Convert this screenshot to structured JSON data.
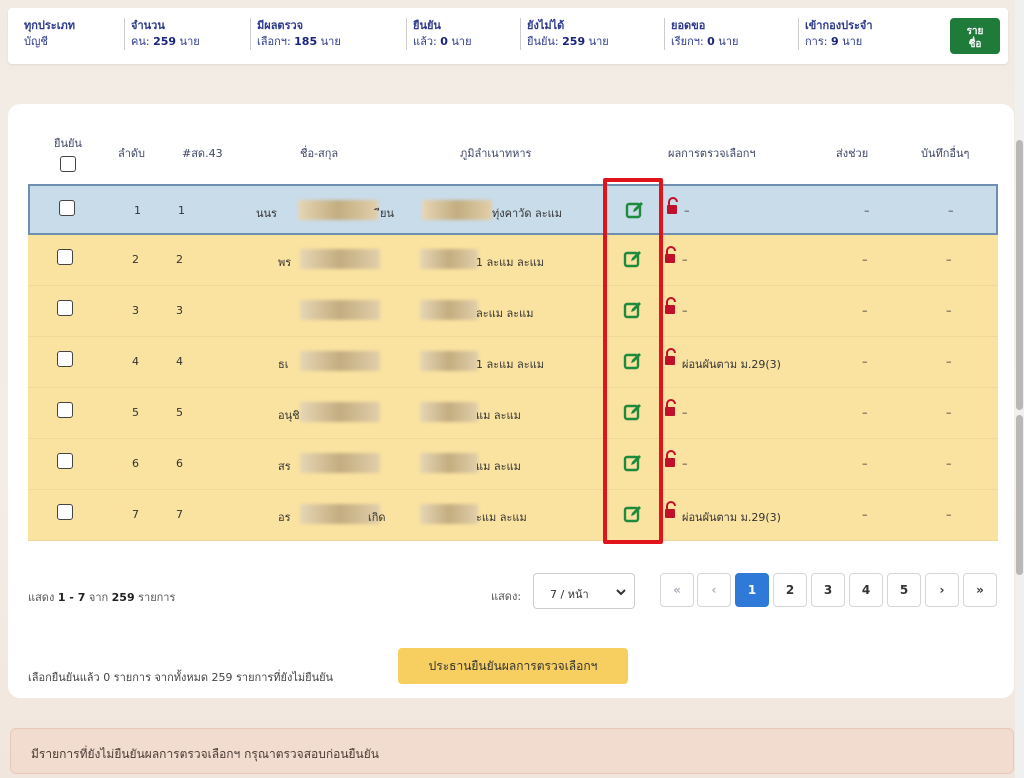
{
  "summary": {
    "types": {
      "line1": "ทุกประเภท",
      "line2": "บัญชี"
    },
    "count": {
      "line1": "จำนวน",
      "prefix": "คน: ",
      "value": "259",
      "unit": " นาย"
    },
    "has_result": {
      "line1": "มีผลตรวจ",
      "prefix": "เลือกฯ: ",
      "value": "185",
      "unit": " นาย"
    },
    "confirmed": {
      "line1": "ยืนยัน",
      "prefix": "แล้ว: ",
      "value": "0",
      "unit": " นาย"
    },
    "not_confirmed": {
      "line1": "ยังไม่ได้",
      "prefix": "ยืนยัน: ",
      "value": "259",
      "unit": " นาย"
    },
    "requested": {
      "line1": "ยอดขอ",
      "prefix": "เรียกฯ: ",
      "value": "0",
      "unit": " นาย"
    },
    "enlisted": {
      "line1": "เข้ากองประจำ",
      "prefix": "การ: ",
      "value": "9",
      "unit": " นาย"
    },
    "list_button": {
      "line1": "ราย",
      "line2": "ชื่อ"
    }
  },
  "table": {
    "headers": {
      "confirm": "ยืนยัน",
      "order": "ลำดับ",
      "sd43": "#สด.43",
      "name": "ชื่อ-สกุล",
      "domicile": "ภูมิลำเนาทหาร",
      "result": "ผลการตรวจเลือกฯ",
      "send": "ส่งช่วย",
      "note": "บันทึกอื่นๆ"
    },
    "rows": [
      {
        "order": "1",
        "sd43": "1",
        "name_a": "นนร",
        "name_b": "ียน",
        "domicile": "ทุ่งคาวัด ละแม",
        "result": "–",
        "send": "–",
        "note": "–"
      },
      {
        "order": "2",
        "sd43": "2",
        "name_a": "พร",
        "name_b": "",
        "domicile": "1 ละแม ละแม",
        "result": "–",
        "send": "–",
        "note": "–"
      },
      {
        "order": "3",
        "sd43": "3",
        "name_a": "",
        "name_b": "",
        "domicile": "ละแม ละแม",
        "result": "–",
        "send": "–",
        "note": "–"
      },
      {
        "order": "4",
        "sd43": "4",
        "name_a": "ธเ",
        "name_b": "",
        "domicile": "1 ละแม ละแม",
        "result": "ผ่อนผันตาม ม.29(3)",
        "send": "–",
        "note": "–"
      },
      {
        "order": "5",
        "sd43": "5",
        "name_a": "อนุชิ",
        "name_b": "",
        "domicile": "แม ละแม",
        "result": "–",
        "send": "–",
        "note": "–"
      },
      {
        "order": "6",
        "sd43": "6",
        "name_a": "สร",
        "name_b": "",
        "domicile": "แม ละแม",
        "result": "–",
        "send": "–",
        "note": "–"
      },
      {
        "order": "7",
        "sd43": "7",
        "name_a": "อร",
        "name_b": "เกิด",
        "domicile": "ะแม ละแม",
        "result": "ผ่อนผันตาม ม.29(3)",
        "send": "–",
        "note": "–"
      }
    ],
    "watermark": "1"
  },
  "pagination": {
    "info_prefix": "แสดง ",
    "info_range": "1 - 7",
    "info_mid": " จาก ",
    "info_total": "259",
    "info_suffix": " รายการ",
    "show_label": "แสดง:",
    "per_page": "7 / หน้า",
    "first": "«",
    "prev": "‹",
    "pages": [
      "1",
      "2",
      "3",
      "4",
      "5"
    ],
    "next": "›",
    "last": "»"
  },
  "confirm": {
    "info": "เลือกยืนยันแล้ว 0 รายการ จากทั้งหมด 259 รายการที่ยังไม่ยืนยัน",
    "button": "ประธานยืนยันผลการตรวจเลือกฯ"
  },
  "alert": "มีรายการที่ยังไม่ยืนยันผลการตรวจเลือกฯ กรุณาตรวจสอบก่อนยืนยัน",
  "colors": {
    "accent": "#2f7ad8",
    "row_highlight": "#fae2a0",
    "row_selected": "#c9dcea",
    "edit_green": "#1e8a3c",
    "lock_red": "#c0102a",
    "confirm_button": "#f6cf60",
    "annotation_red": "#e0141a"
  }
}
